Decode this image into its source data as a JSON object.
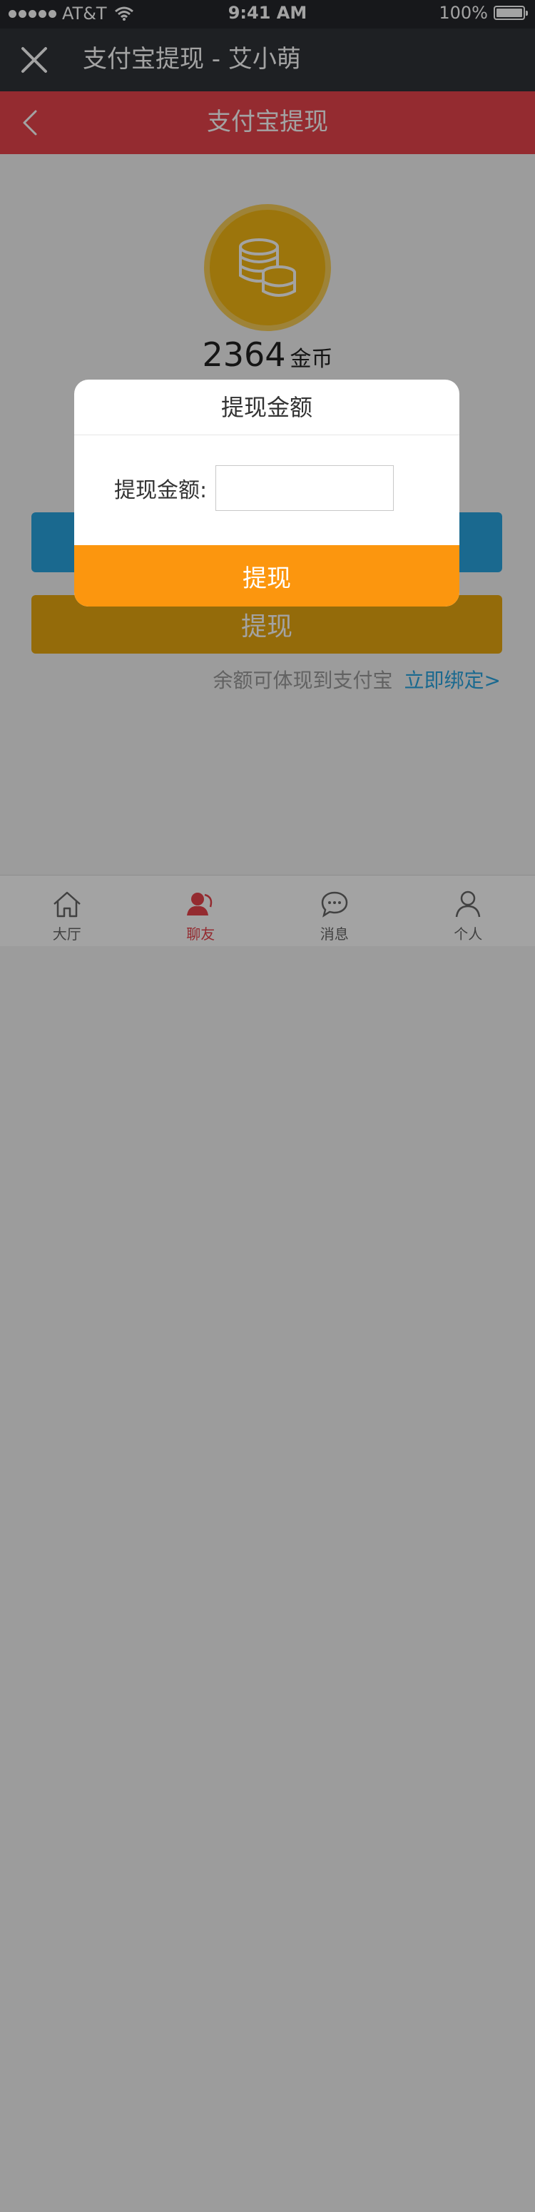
{
  "status_bar": {
    "carrier": "AT&T",
    "time": "9:41 AM",
    "battery": "100%"
  },
  "nav": {
    "title": "支付宝提现 - 艾小萌"
  },
  "header": {
    "title": "支付宝提现"
  },
  "balance": {
    "amount": "2364",
    "unit": "金币"
  },
  "buttons": {
    "withdraw_label": "提现"
  },
  "hint": {
    "text": "余额可体现到支付宝",
    "link": "立即绑定>"
  },
  "tabs": [
    {
      "label": "大厅",
      "icon": "home-icon",
      "active": false
    },
    {
      "label": "聊友",
      "icon": "friends-icon",
      "active": true
    },
    {
      "label": "消息",
      "icon": "message-icon",
      "active": false
    },
    {
      "label": "个人",
      "icon": "person-icon",
      "active": false
    }
  ],
  "modal": {
    "title": "提现金额",
    "label": "提现金额:",
    "input_value": "",
    "submit_label": "提现"
  },
  "colors": {
    "header_red": "#e8444c",
    "nav_dark": "#2f3238",
    "coin_gold": "#f4b814",
    "button_blue": "#2aa5e0",
    "button_gold": "#e8a810",
    "submit_orange": "#fc960e",
    "link_blue": "#2aa5e0"
  }
}
